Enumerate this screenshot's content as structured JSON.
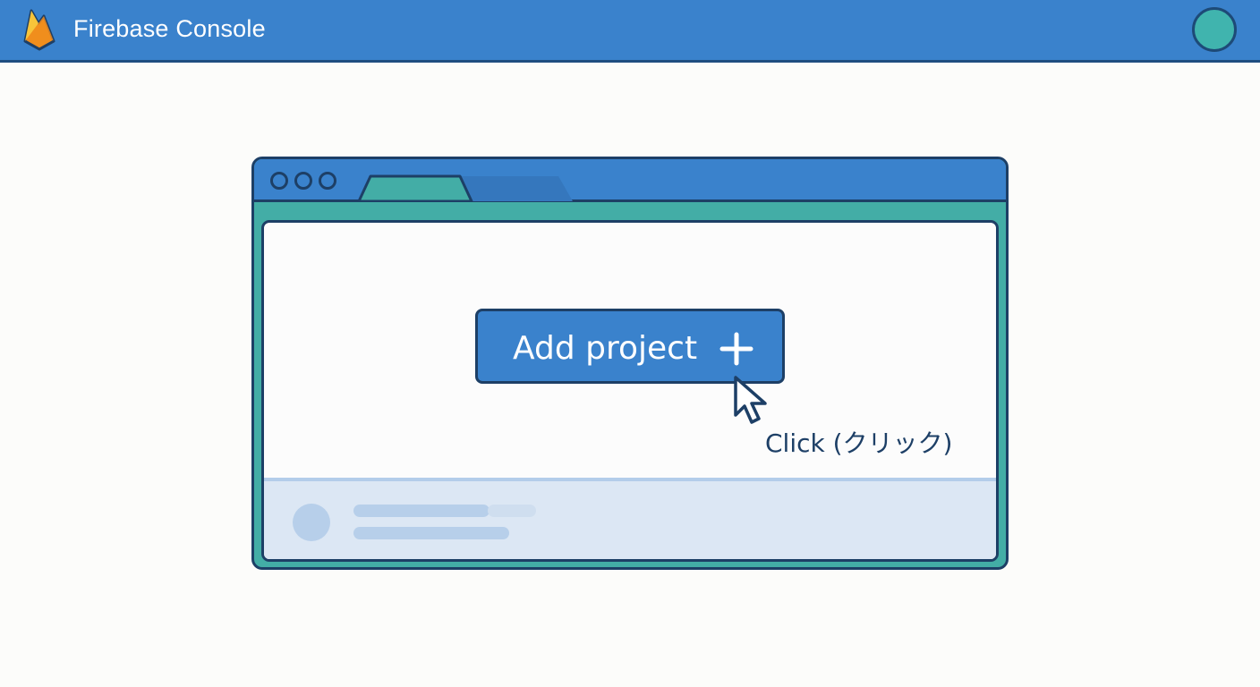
{
  "header": {
    "title": "Firebase Console",
    "logo_icon": "firebase-flame-icon",
    "avatar_icon": "user-avatar"
  },
  "browser": {
    "window_dots": 3,
    "tabs": [
      {
        "state": "active"
      },
      {
        "state": "inactive"
      }
    ],
    "main_button": {
      "label": "Add project",
      "icon": "plus-icon"
    },
    "cursor_icon": "pointer-cursor-icon",
    "hint": "Click (クリック)"
  },
  "colors": {
    "brand_blue": "#3a82cc",
    "teal": "#43ada6",
    "outline": "#1d3f66",
    "panel": "#dce7f4"
  }
}
